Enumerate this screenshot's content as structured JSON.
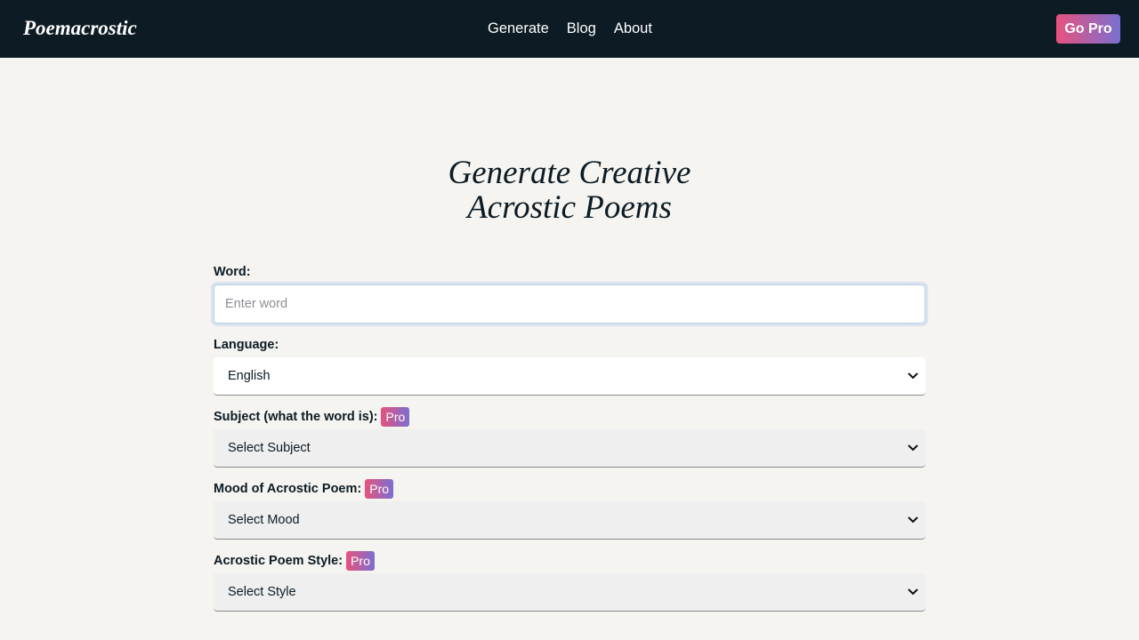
{
  "nav": {
    "brand": "Poemacrostic",
    "links": [
      "Generate",
      "Blog",
      "About"
    ],
    "cta_label": "Go Pro"
  },
  "hero": {
    "title_line1": "Generate Creative",
    "title_line2": "Acrostic Poems"
  },
  "form": {
    "word": {
      "label": "Word:",
      "placeholder": "Enter word",
      "value": ""
    },
    "language": {
      "label": "Language:",
      "selected": "English"
    },
    "subject": {
      "label": "Subject (what the word is):",
      "badge": "Pro",
      "selected": "Select Subject"
    },
    "mood": {
      "label": "Mood of Acrostic Poem:",
      "badge": "Pro",
      "selected": "Select Mood"
    },
    "style": {
      "label": "Acrostic Poem Style:",
      "badge": "Pro",
      "selected": "Select Style"
    }
  },
  "colors": {
    "nav_bg": "#0c1b24",
    "page_bg": "#f5f4f0",
    "pro_gradient_start": "#e8527d",
    "pro_gradient_end": "#7b6fd0"
  },
  "icons": {
    "select_arrow": "chevron-down-icon"
  }
}
